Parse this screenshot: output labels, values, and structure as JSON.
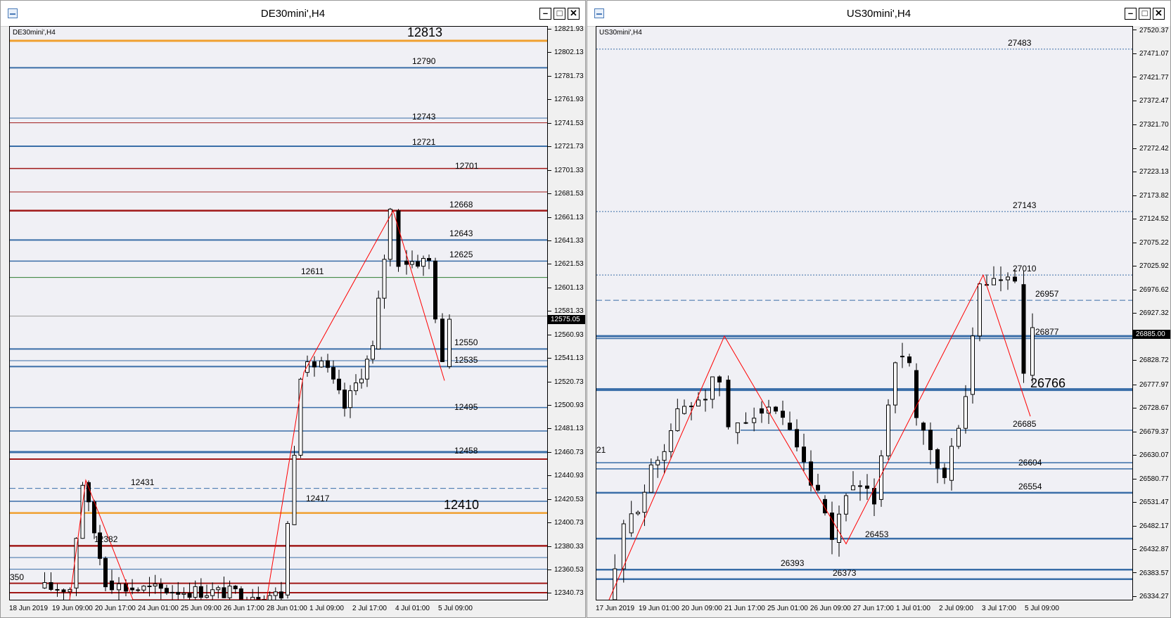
{
  "left": {
    "title": "DE30mini',H4",
    "symbol": "DE30mini',H4",
    "price_min": 12336,
    "price_max": 12825,
    "current_price": "12575.05",
    "price_ticks": [
      "12821.93",
      "12802.13",
      "12781.73",
      "12761.93",
      "12741.53",
      "12721.73",
      "12701.33",
      "12681.53",
      "12661.13",
      "12641.33",
      "12621.53",
      "12601.13",
      "12581.33",
      "12560.93",
      "12541.13",
      "12520.73",
      "12500.93",
      "12481.13",
      "12460.73",
      "12440.93",
      "12420.53",
      "12400.73",
      "12380.33",
      "12360.53",
      "12340.73"
    ],
    "time_ticks": [
      "18 Jun 2019",
      "19 Jun 09:00",
      "20 Jun 17:00",
      "24 Jun 01:00",
      "25 Jun 09:00",
      "26 Jun 17:00",
      "28 Jun 01:00",
      "1 Jul 09:00",
      "2 Jul 17:00",
      "4 Jul 01:00",
      "5 Jul 09:00"
    ],
    "level_labels": [
      {
        "text": "12813",
        "big": true
      },
      {
        "text": "12790"
      },
      {
        "text": "12743"
      },
      {
        "text": "12721"
      },
      {
        "text": "12701"
      },
      {
        "text": "12668"
      },
      {
        "text": "12643"
      },
      {
        "text": "12625"
      },
      {
        "text": "12611"
      },
      {
        "text": "12550"
      },
      {
        "text": "12535"
      },
      {
        "text": "12495"
      },
      {
        "text": "12458"
      },
      {
        "text": "12431"
      },
      {
        "text": "12417"
      },
      {
        "text": "12410",
        "big": true
      },
      {
        "text": "12382"
      },
      {
        "text": "350"
      }
    ],
    "colors": {
      "orange": "#f0a030",
      "blue": "#3a6ea8",
      "red": "#a01818",
      "green": "#2e7d32",
      "zigzag": "#ff0000",
      "candle": "#000000"
    }
  },
  "right": {
    "title": "US30mini',H4",
    "symbol": "US30mini',H4",
    "price_min": 26330,
    "price_max": 27530,
    "current_price": "26885.00",
    "price_ticks": [
      "27520.37",
      "27471.07",
      "27421.77",
      "27372.47",
      "27321.70",
      "27272.42",
      "27223.13",
      "27173.82",
      "27124.52",
      "27075.22",
      "27025.92",
      "26976.62",
      "26927.32",
      "26878.02",
      "26828.72",
      "26777.97",
      "26728.67",
      "26679.37",
      "26630.07",
      "26580.77",
      "26531.47",
      "26482.17",
      "26432.87",
      "26383.57",
      "26334.27"
    ],
    "time_ticks": [
      "17 Jun 2019",
      "19 Jun 01:00",
      "20 Jun 09:00",
      "21 Jun 17:00",
      "25 Jun 01:00",
      "26 Jun 09:00",
      "27 Jun 17:00",
      "1 Jul 01:00",
      "2 Jul 09:00",
      "3 Jul 17:00",
      "5 Jul 09:00"
    ],
    "level_labels": [
      {
        "text": "27483"
      },
      {
        "text": "27143"
      },
      {
        "text": "27010"
      },
      {
        "text": "26957"
      },
      {
        "text": "26877"
      },
      {
        "text": "26766",
        "big": true
      },
      {
        "text": "26685"
      },
      {
        "text": "26604"
      },
      {
        "text": "26554"
      },
      {
        "text": "26453"
      },
      {
        "text": "26393"
      },
      {
        "text": "26373"
      },
      {
        "text": "21"
      }
    ]
  }
}
